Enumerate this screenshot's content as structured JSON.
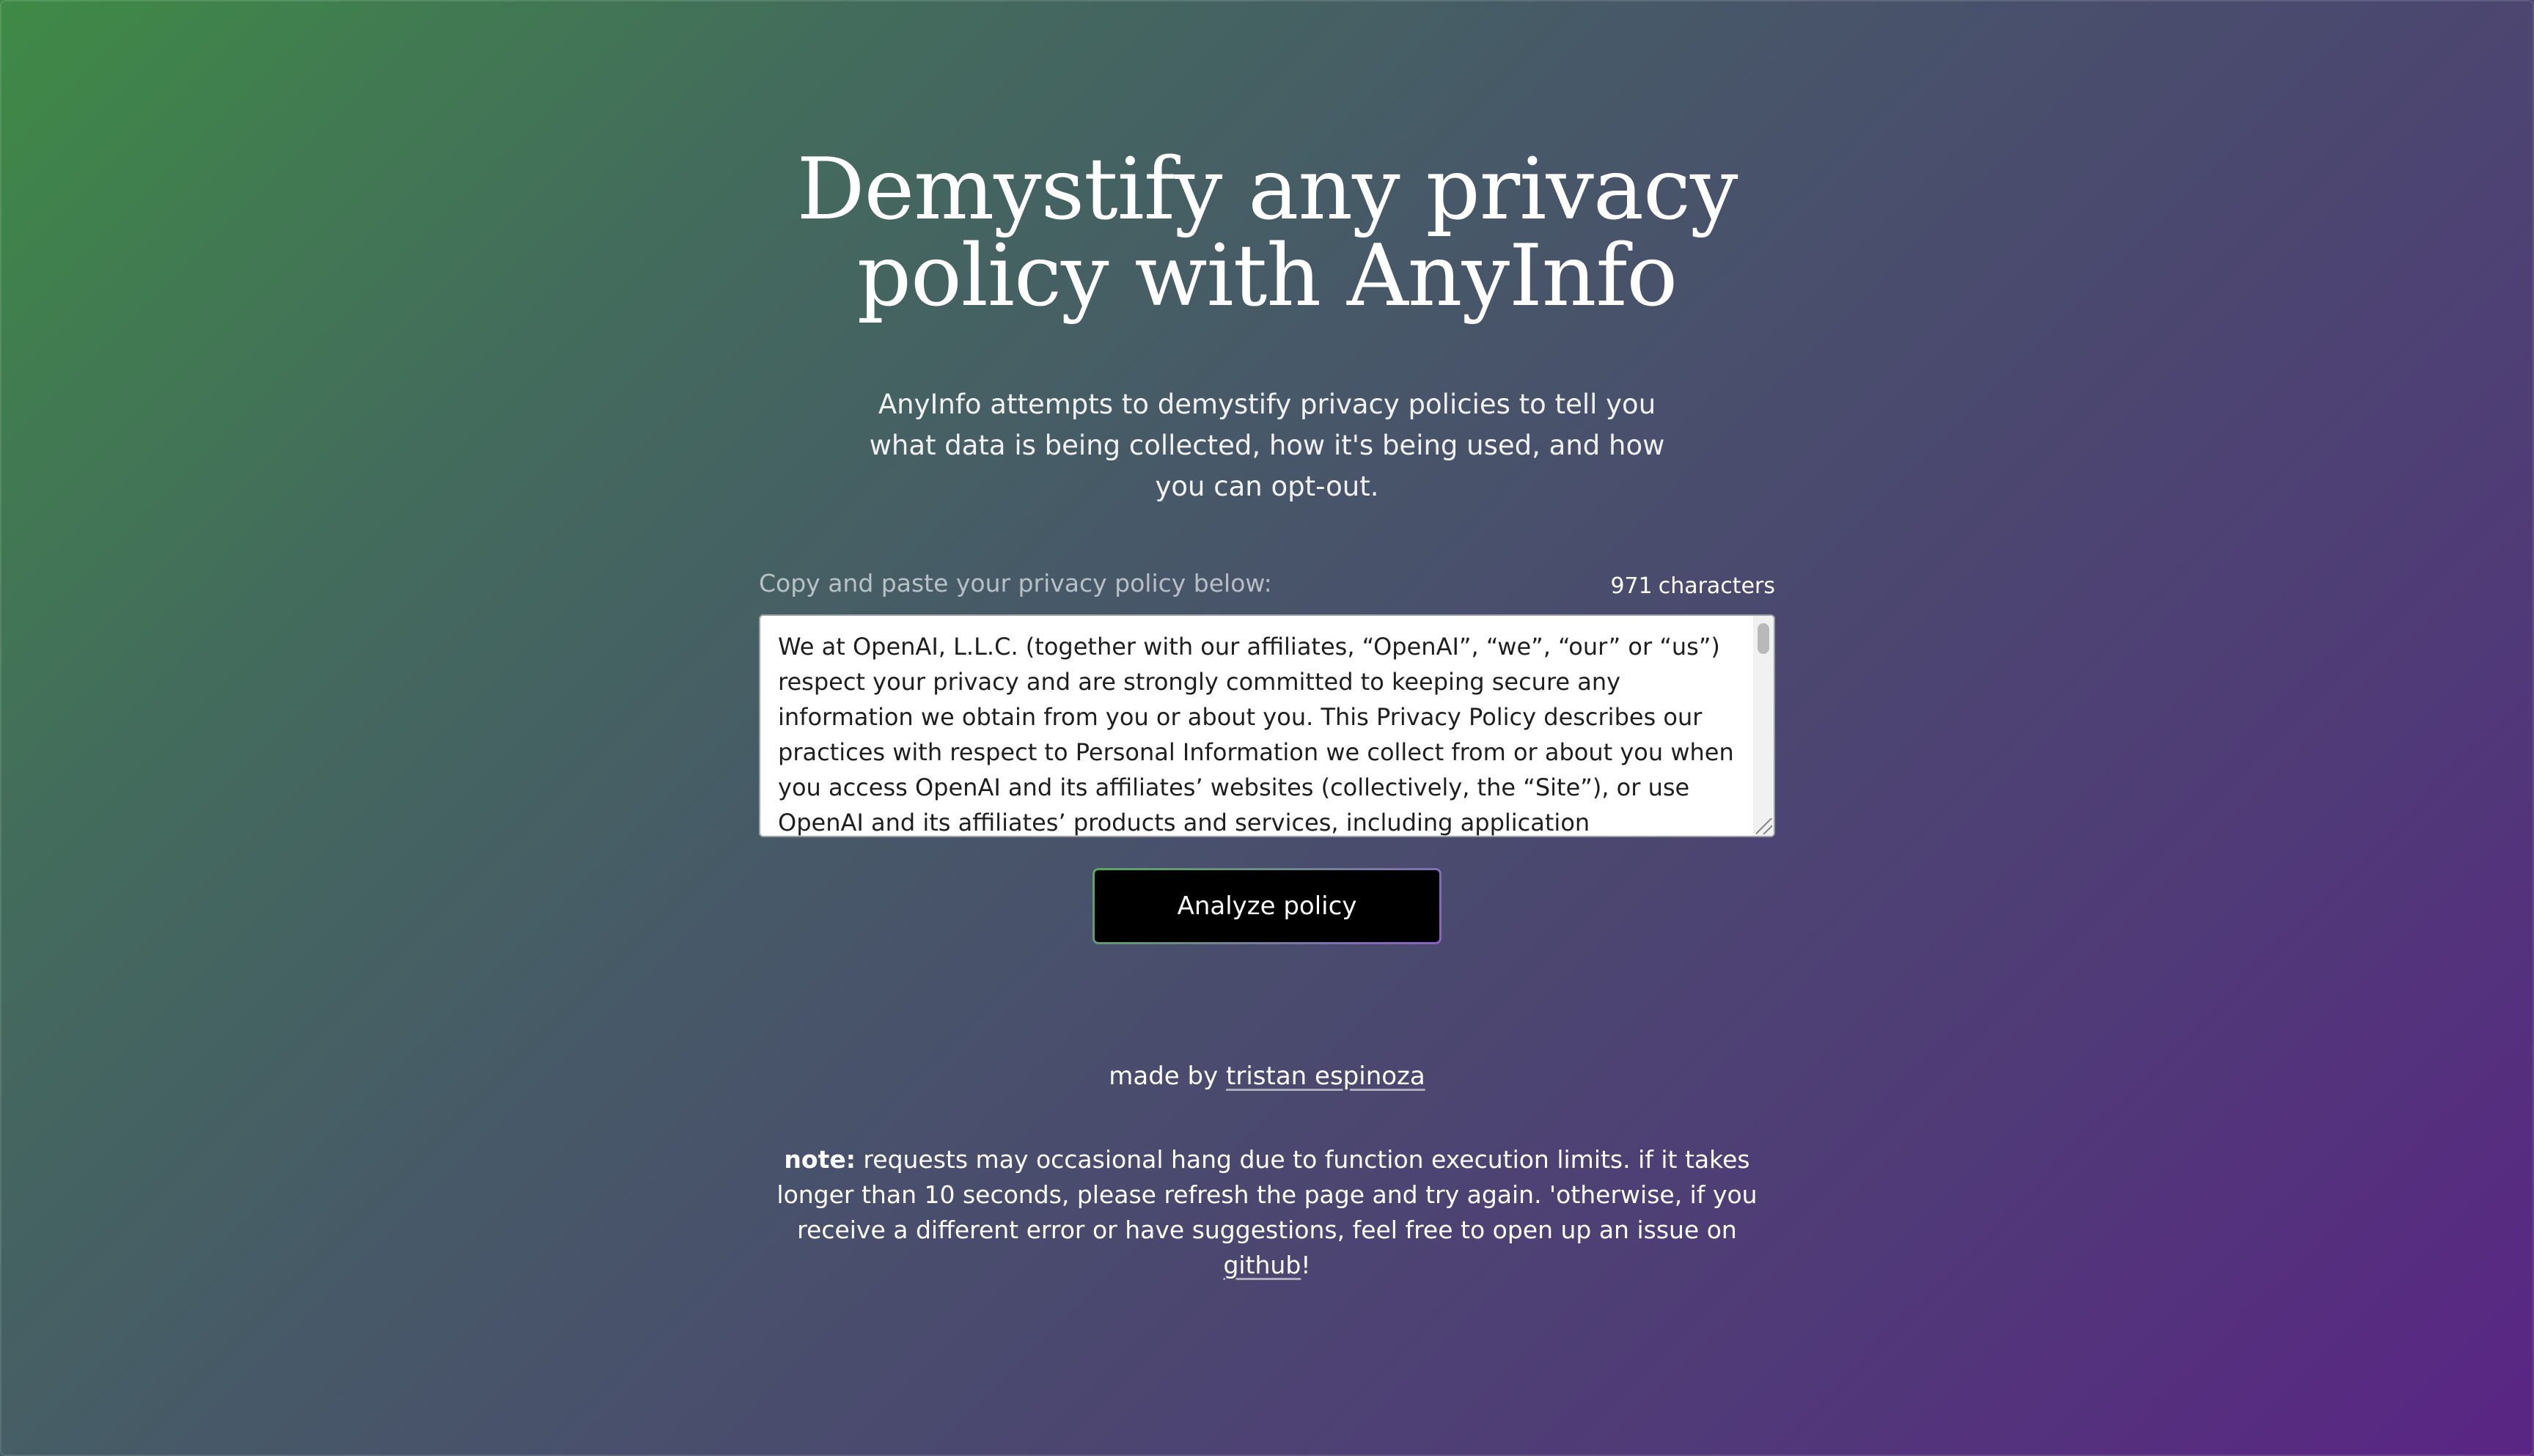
{
  "hero": {
    "title_line1": "Demystify any privacy",
    "title_line2": "policy with AnyInfo",
    "subtitle": "AnyInfo attempts to demystify privacy policies to tell you what data is being collected, how it's being used, and how you can opt-out."
  },
  "form": {
    "label": "Copy and paste your privacy policy below:",
    "char_count": "971",
    "char_count_unit": "characters",
    "policy_text": "We at OpenAI, L.L.C. (together with our affiliates, “OpenAI”, “we”, “our” or “us”) respect your privacy and are strongly committed to keeping secure any information we obtain from you or about you. This Privacy Policy describes our practices with respect to Personal Information we collect from or about you when you access OpenAI and its affiliates’ websites (collectively, the “Site”), or use OpenAI and its affiliates’ products and services, including application programming interfaces, associated software,",
    "button_label": "Analyze policy"
  },
  "footer": {
    "made_by_prefix": "made by",
    "author_link": "tristan espinoza",
    "note_label": "note:",
    "note_text": " requests may occasional hang due to function execution limits. if it takes longer than 10 seconds, please refresh the page and try again. 'otherwise, if you receive a different error or have suggestions, feel free to open up an issue on ",
    "github_link": "github",
    "note_end": "!"
  },
  "colors": {
    "gradient_start": "#3f8a46",
    "gradient_end": "#5a2584",
    "button_bg": "#000000"
  }
}
